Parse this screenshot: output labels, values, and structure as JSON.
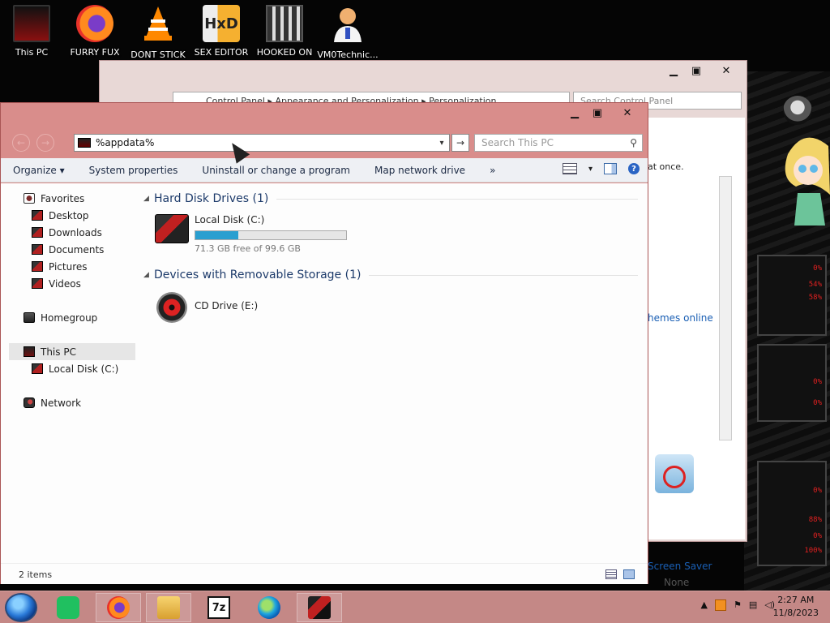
{
  "desktop": {
    "icons": [
      {
        "label": "This PC"
      },
      {
        "label": "FURRY FUX"
      },
      {
        "label": "DONT STICK"
      },
      {
        "label": "SEX EDITOR"
      },
      {
        "label": "HOOKED ON"
      },
      {
        "label": "VM0Technic..."
      }
    ],
    "wallpaper_percents": [
      "0%",
      "54%",
      "58%",
      "0%",
      "0%",
      "0%",
      "88%",
      "0%",
      "100%"
    ]
  },
  "back_window": {
    "address_path": "Control Panel  ▸  Appearance and Personalization  ▸  Personalization",
    "search_placeholder": "Search Control Panel",
    "text_fragment_1": "at once.",
    "link_fragment": "hemes online",
    "screen_saver_label": "Screen Saver",
    "screen_saver_value": "None"
  },
  "window": {
    "address_value": "%appdata%",
    "search_placeholder": "Search This PC",
    "toolbar": {
      "organize": "Organize ▾",
      "system_properties": "System properties",
      "uninstall": "Uninstall or change a program",
      "map_drive": "Map network drive",
      "more": "»"
    },
    "nav": {
      "favorites": "Favorites",
      "desktop": "Desktop",
      "downloads": "Downloads",
      "documents": "Documents",
      "pictures": "Pictures",
      "videos": "Videos",
      "homegroup": "Homegroup",
      "this_pc": "This PC",
      "local_disk": "Local Disk (C:)",
      "network": "Network"
    },
    "groups": {
      "hdd_header": "Hard Disk Drives (1)",
      "removable_header": "Devices with Removable Storage (1)"
    },
    "drives": {
      "c_name": "Local Disk (C:)",
      "c_free": "71.3 GB free of 99.6 GB",
      "c_used_fraction": 0.284,
      "e_name": "CD Drive (E:)"
    },
    "status": {
      "count": "2 items"
    }
  },
  "taskbar": {
    "time": "2:27 AM",
    "date": "11/8/2023",
    "seven_zip": "7z"
  },
  "colors": {
    "window_frame": "#d98d8b",
    "taskbar": "#c48886",
    "accent_bar": "#2a9fd0"
  }
}
